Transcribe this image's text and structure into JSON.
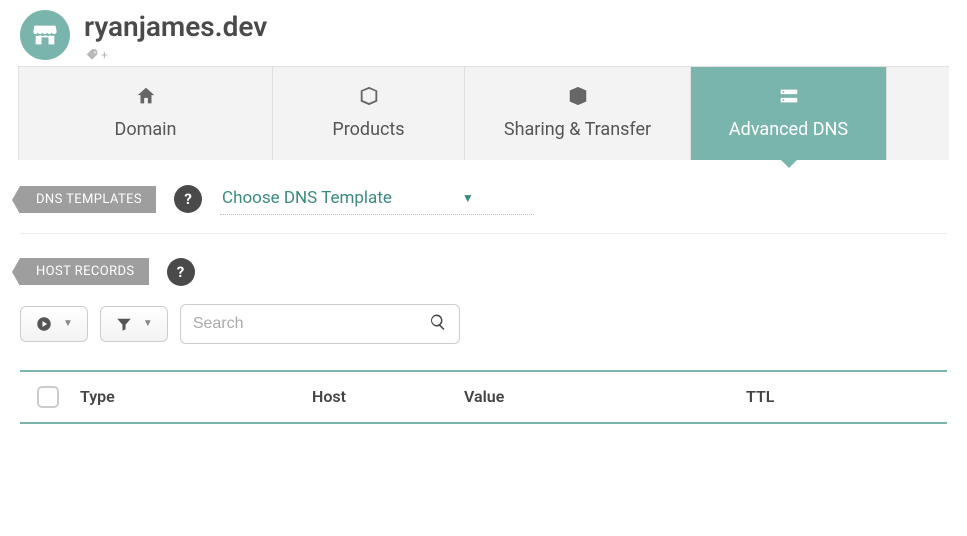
{
  "header": {
    "domain": "ryanjames.dev"
  },
  "tabs": [
    {
      "label": "Domain"
    },
    {
      "label": "Products"
    },
    {
      "label": "Sharing & Transfer"
    },
    {
      "label": "Advanced DNS"
    }
  ],
  "activeTabIndex": 3,
  "dnsTemplates": {
    "chipLabel": "DNS TEMPLATES",
    "helpSymbol": "?",
    "dropdownLabel": "Choose DNS Template"
  },
  "hostRecords": {
    "chipLabel": "HOST RECORDS",
    "helpSymbol": "?"
  },
  "toolbar": {
    "searchPlaceholder": "Search"
  },
  "table": {
    "columns": {
      "type": "Type",
      "host": "Host",
      "value": "Value",
      "ttl": "TTL"
    }
  },
  "colors": {
    "accent": "#7ab5ad",
    "chip": "#9e9e9e",
    "help": "#4a4a4a"
  }
}
